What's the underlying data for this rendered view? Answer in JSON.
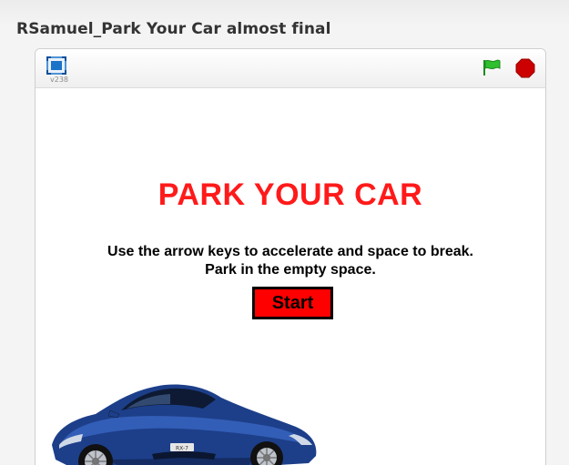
{
  "project": {
    "title": "RSamuel_Park Your Car almost final"
  },
  "player": {
    "version": "v238",
    "icons": {
      "fullscreen": "fullscreen-icon",
      "green_flag": "green-flag-icon",
      "stop": "stop-sign-icon"
    },
    "colors": {
      "accent_blue": "#1a73c9",
      "flag_green": "#2fbf2f",
      "stop_red": "#cc0000"
    }
  },
  "stage": {
    "title": "PARK YOUR CAR",
    "instructions_line1": "Use the arrow keys to accelerate and space to break.",
    "instructions_line2": "Park in the empty space.",
    "start_label": "Start",
    "title_color": "#ff1a1a",
    "start_bg": "#ff0000",
    "car": {
      "badge_text": "RX-7",
      "body_color": "#1d3f8a"
    }
  }
}
